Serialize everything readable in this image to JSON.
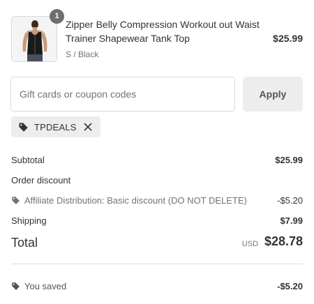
{
  "product": {
    "quantity": "1",
    "title": "Zipper Belly Compression Workout out Waist Trainer Shapewear Tank Top",
    "variant": "S / Black",
    "price": "$25.99",
    "image_icon": "product-photo-black-tank-top"
  },
  "discount_form": {
    "placeholder": "Gift cards or coupon codes",
    "value": "",
    "apply_label": "Apply"
  },
  "applied_code": {
    "code": "TPDEALS",
    "tag_icon": "tag-icon",
    "remove_icon": "close-icon"
  },
  "summary": {
    "subtotal_label": "Subtotal",
    "subtotal_value": "$25.99",
    "order_discount_label": "Order discount",
    "discount_name": "Affiliate Distribution: Basic discount (DO NOT DELETE)",
    "discount_value": "-$5.20",
    "shipping_label": "Shipping",
    "shipping_value": "$7.99",
    "total_label": "Total",
    "currency": "USD",
    "total_value": "$28.78"
  },
  "saved": {
    "label": "You saved",
    "value": "-$5.20"
  },
  "colors": {
    "badge": "#6e6e6e",
    "button_bg": "#ededed",
    "border": "#d9d9d9",
    "text": "#333333",
    "muted": "#737373"
  }
}
